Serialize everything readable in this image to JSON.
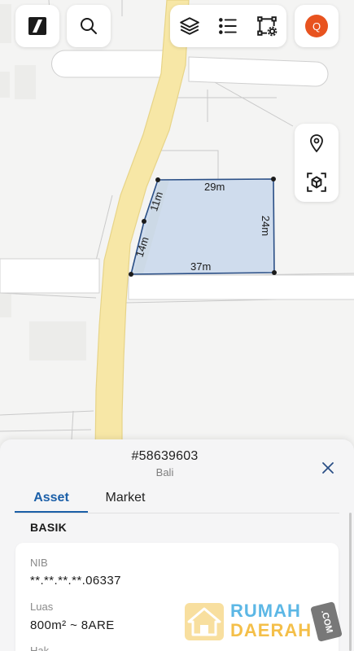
{
  "map": {
    "dimensions": {
      "top": "29m",
      "right": "24m",
      "bottom": "37m",
      "left_upper": "11m",
      "left_lower": "14m"
    },
    "colors": {
      "road": "#f7e7a6",
      "road_edge": "#e7d488",
      "parcel_fill": "#c9d8ec",
      "parcel_stroke": "#2b4f86",
      "background": "#f4f4f3"
    }
  },
  "toolbar": {
    "logo_icon": "brand-logo-icon",
    "search_icon": "search-icon",
    "layers_icon": "layers-icon",
    "list_icon": "list-icon",
    "polygon_tool_icon": "polygon-settings-icon",
    "avatar_initial": "Q",
    "avatar_color": "#e8531f"
  },
  "side_tools": {
    "pin_icon": "location-pin-icon",
    "scan_icon": "3d-scan-icon"
  },
  "sheet": {
    "title": "#58639603",
    "subtitle": "Bali",
    "tabs": [
      {
        "label": "Asset",
        "active": true
      },
      {
        "label": "Market",
        "active": false
      }
    ],
    "accent": "#1b5fa8",
    "section_title": "BASIK",
    "fields": [
      {
        "label": "NIB",
        "value": "**.**.**.**.06337"
      },
      {
        "label": "Luas",
        "value": "800m² ~ 8ARE"
      },
      {
        "label": "Hak",
        "value": ""
      }
    ]
  },
  "watermark": {
    "line1": "RUMAH",
    "line2": "DAERAH",
    "suffix": ".COM"
  }
}
